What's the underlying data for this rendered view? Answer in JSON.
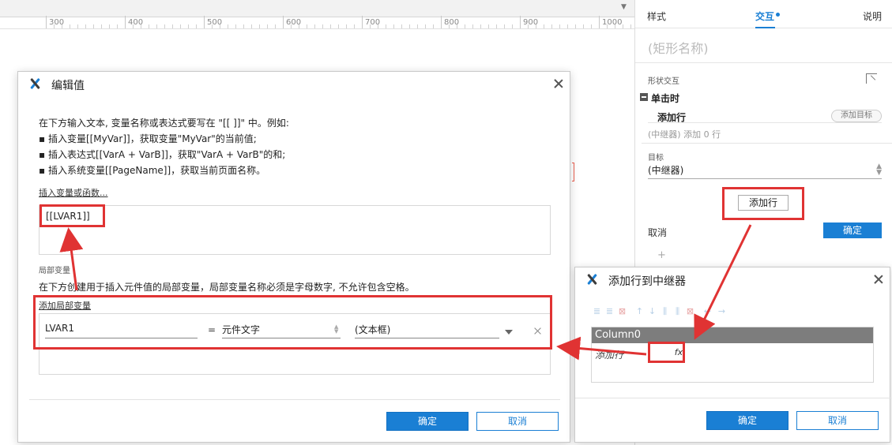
{
  "ruler": {
    "labels": [
      "300",
      "400",
      "500",
      "600",
      "700",
      "800",
      "900",
      "1000"
    ]
  },
  "inspector": {
    "tabs": [
      "样式",
      "交互",
      "说明"
    ],
    "shape_name": "(矩形名称)",
    "section_label": "形状交互",
    "event": "单击时",
    "action": "添加行",
    "add_target": "添加目标",
    "action_detail": "(中继器) 添加 0 行",
    "target_label": "目标",
    "target_value": "(中继器)",
    "add_row_button": "添加行",
    "cancel": "取消",
    "ok": "确定",
    "plus": "+"
  },
  "edit_dialog": {
    "title": "编辑值",
    "instructions": [
      "在下方输入文本, 变量名称或表达式要写在 \"[[ ]]\" 中。例如:",
      "▪ 插入变量[[MyVar]]，获取变量\"MyVar\"的当前值;",
      "▪ 插入表达式[[VarA + VarB]]，获取\"VarA + VarB\"的和;",
      "▪ 插入系统变量[[PageName]]，获取当前页面名称。"
    ],
    "insert_link": "插入变量或函数...",
    "expression": "[[LVAR1]]",
    "local_vars_title": "局部变量",
    "local_vars_desc": "在下方创建用于插入元件值的局部变量，局部变量名称必须是字母数字, 不允许包含空格。",
    "add_local_var": "添加局部变量",
    "var_name": "LVAR1",
    "equals": "=",
    "var_type": "元件文字",
    "var_target": "(文本框)",
    "ok": "确定",
    "cancel": "取消"
  },
  "repeater_dialog": {
    "title": "添加行到中继器",
    "column_header": "Column0",
    "row_label": "添加行",
    "fx_label": "fx",
    "ok": "确定",
    "cancel": "取消"
  }
}
